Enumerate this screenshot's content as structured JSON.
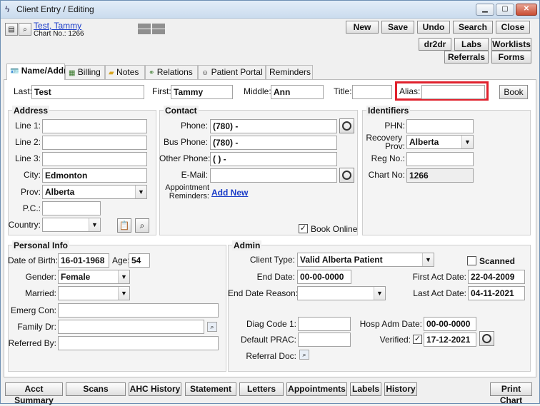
{
  "window": {
    "title": "Client Entry / Editing"
  },
  "header": {
    "client_name": "Test, Tammy",
    "chart_no": "Chart No.: 1266"
  },
  "toolbar": {
    "new": "New",
    "save": "Save",
    "undo": "Undo",
    "search": "Search",
    "close": "Close",
    "dr2dr": "dr2dr",
    "labs": "Labs",
    "worklists": "Worklists",
    "referrals": "Referrals",
    "forms": "Forms"
  },
  "tabs": [
    "Name/Addr",
    "Billing",
    "Notes",
    "Relations",
    "Patient Portal",
    "Reminders"
  ],
  "name": {
    "last_label": "Last:",
    "last": "Test",
    "first_label": "First:",
    "first": "Tammy",
    "middle_label": "Middle:",
    "middle": "Ann",
    "title_label": "Title:",
    "title": "",
    "alias_label": "Alias:",
    "alias": "",
    "book": "Book"
  },
  "address": {
    "title": "Address",
    "line1_label": "Line 1:",
    "line2_label": "Line 2:",
    "line3_label": "Line 3:",
    "city_label": "City:",
    "city": "Edmonton",
    "prov_label": "Prov:",
    "prov": "Alberta",
    "pc_label": "P.C.:",
    "country_label": "Country:"
  },
  "contact": {
    "title": "Contact",
    "phone_label": "Phone:",
    "phone": "(780)   -",
    "bus_label": "Bus Phone:",
    "bus": "(780)   -",
    "other_label": "Other Phone:",
    "other": "(   )   -",
    "email_label": "E-Mail:",
    "appt_label1": "Appointment",
    "appt_label2": "Reminders:",
    "add_new": "Add New",
    "book_online": "Book Online"
  },
  "identifiers": {
    "title": "Identifiers",
    "phn_label": "PHN:",
    "rec_label1": "Recovery",
    "rec_label2": "Prov:",
    "rec_prov": "Alberta",
    "reg_label": "Reg No.:",
    "chart_label": "Chart No:",
    "chart_no": "1266"
  },
  "personal": {
    "title": "Personal Info",
    "dob_label": "Date of Birth:",
    "dob": "16-01-1968",
    "age_label": "Age:",
    "age": "54",
    "gender_label": "Gender:",
    "gender": "Female",
    "married_label": "Married:",
    "emerg_label": "Emerg Con:",
    "family_label": "Family Dr:",
    "referred_label": "Referred By:"
  },
  "admin": {
    "title": "Admin",
    "type_label": "Client Type:",
    "type": "Valid Alberta Patient",
    "scanned": "Scanned",
    "end_label": "End Date:",
    "end": "00-00-0000",
    "first_act_label": "First Act Date:",
    "first_act": "22-04-2009",
    "end_reason_label": "End Date Reason:",
    "last_act_label": "Last Act Date:",
    "last_act": "04-11-2021",
    "diag_label": "Diag Code 1:",
    "hosp_label": "Hosp Adm Date:",
    "hosp": "00-00-0000",
    "prac_label": "Default PRAC:",
    "verified_label": "Verified:",
    "verified": "17-12-2021",
    "refdoc_label": "Referral Doc:"
  },
  "bottom": [
    "Acct Summary",
    "Scans",
    "AHC History",
    "Statement",
    "Letters",
    "Appointments",
    "Labels",
    "History",
    "Print Chart"
  ],
  "colors": {
    "highlight": "#e0202c",
    "link": "#1a3cc8"
  }
}
